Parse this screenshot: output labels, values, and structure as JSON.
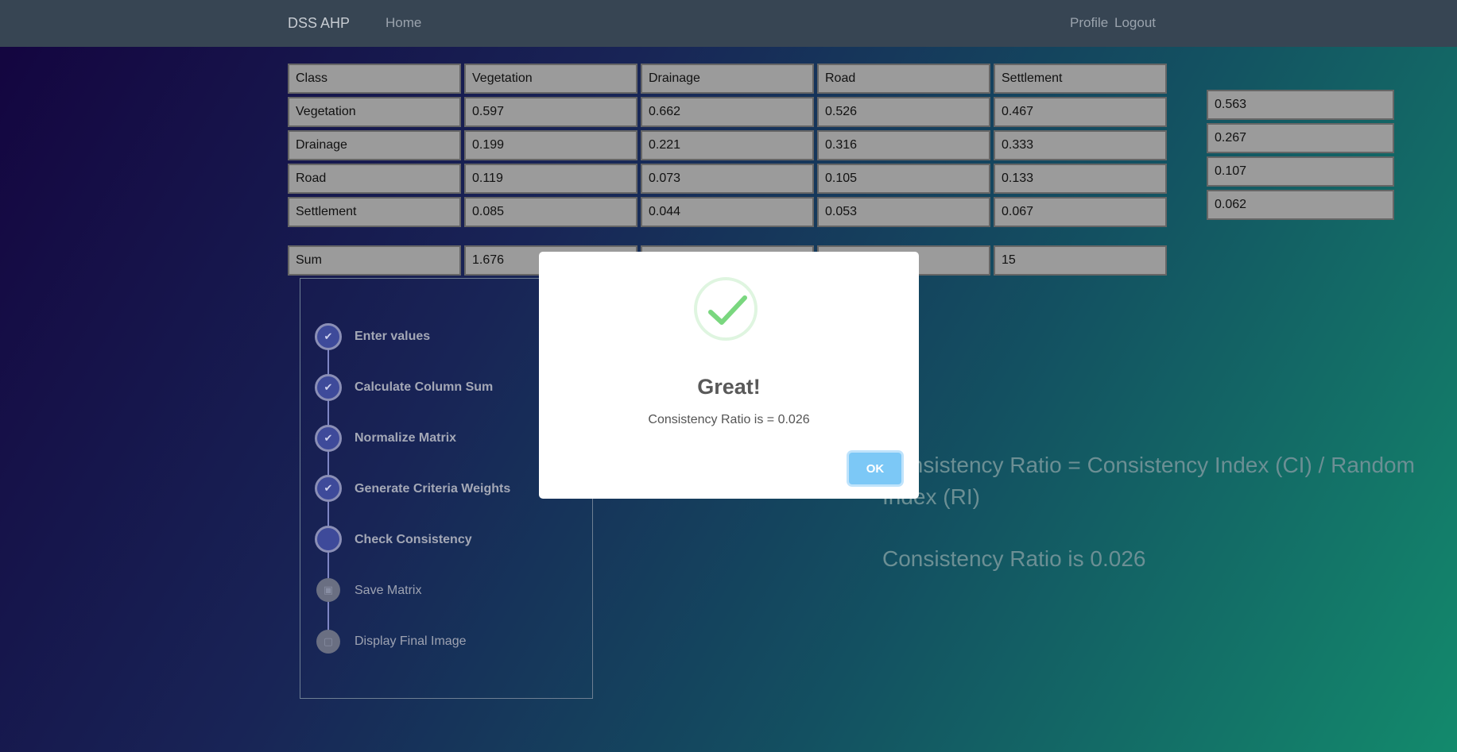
{
  "navbar": {
    "brand": "DSS AHP",
    "home": "Home",
    "profile": "Profile",
    "logout": "Logout"
  },
  "matrix": {
    "headers": [
      "Class",
      "Vegetation",
      "Drainage",
      "Road",
      "Settlement"
    ],
    "rows": [
      {
        "label": "Vegetation",
        "values": [
          "0.597",
          "0.662",
          "0.526",
          "0.467"
        ]
      },
      {
        "label": "Drainage",
        "values": [
          "0.199",
          "0.221",
          "0.316",
          "0.333"
        ]
      },
      {
        "label": "Road",
        "values": [
          "0.119",
          "0.073",
          "0.105",
          "0.133"
        ]
      },
      {
        "label": "Settlement",
        "values": [
          "0.085",
          "0.044",
          "0.053",
          "0.067"
        ]
      }
    ],
    "sum": {
      "label": "Sum",
      "values": [
        "1.676",
        "",
        "",
        "15"
      ]
    }
  },
  "weights": [
    "0.563",
    "0.267",
    "0.107",
    "0.062"
  ],
  "stepper": {
    "steps": [
      {
        "label": "Enter values",
        "state": "done",
        "icon": "check-icon"
      },
      {
        "label": "Calculate Column Sum",
        "state": "done",
        "icon": "check-icon"
      },
      {
        "label": "Normalize Matrix",
        "state": "done",
        "icon": "check-icon"
      },
      {
        "label": "Generate Criteria Weights",
        "state": "done",
        "icon": "check-icon"
      },
      {
        "label": "Check Consistency",
        "state": "active",
        "icon": ""
      },
      {
        "label": "Save Matrix",
        "state": "pending",
        "icon": "save-icon"
      },
      {
        "label": "Display Final Image",
        "state": "pending",
        "icon": "image-icon"
      }
    ]
  },
  "formula": "Consistency Ratio = Consistency Index (CI) / Random Index (RI)",
  "result_text": "Consistency Ratio is 0.026",
  "modal": {
    "title": "Great!",
    "text": "Consistency Ratio is = 0.026",
    "ok_label": "OK",
    "icon": "success-check-icon"
  },
  "colors": {
    "navbar": "#374553",
    "ok_button": "#7cc8f6",
    "step_active": "#3e4a9a",
    "success": "#7ad77f"
  }
}
